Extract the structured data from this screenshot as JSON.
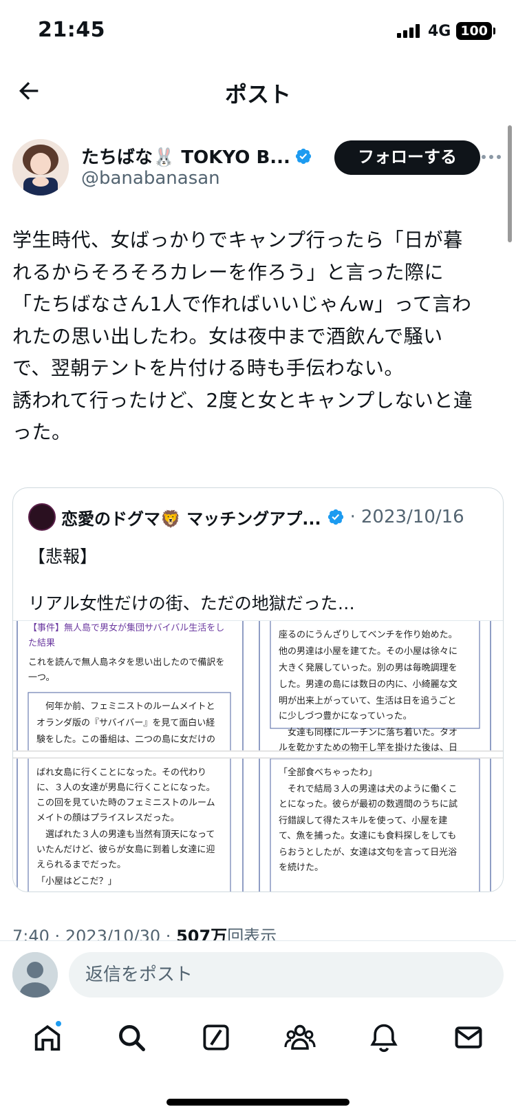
{
  "status_bar": {
    "time": "21:45",
    "network": "4G",
    "battery": "100"
  },
  "header": {
    "title": "ポスト"
  },
  "author": {
    "display_name": "たちばな🐰 TOKYO B...",
    "handle": "@banabanasan",
    "follow_label": "フォローする"
  },
  "post": {
    "text": "学生時代、女ばっかりでキャンプ行ったら「日が暮\nれるからそろそろカレーを作ろう」と言った際に\n「たちばなさん1人で作ればいいじゃんw」って言わ\nれたの思い出したわ。女は夜中まで酒飲んで騒い\nで、翌朝テントを片付ける時も手伝わない。\n誘われて行ったけど、2度と女とキャンプしないと違\nった。"
  },
  "quote": {
    "display_name": "恋愛のドグマ🦁 マッチングアプ...",
    "separator": "·",
    "date": "2023/10/16",
    "tag": "【悲報】",
    "text": "リアル女性だけの街、ただの地獄だった…",
    "image_left": {
      "heading": [
        "【事件】無人島で男女が集団サバイバル生活をし",
        "た結果"
      ],
      "lines": [
        "これを読んで無人島ネタを思い出したので備訳を",
        "一つ。",
        "　何年か前、フェミニストのルームメイトと",
        "オランダ版の『サバイバー』を見て面白い経",
        "験をした。この番組は、二つの島に女だけの",
        "ばれ女島に行くことになった。その代わり",
        "に、３人の女達が男島に行くことになった。",
        "この回を見ていた時のフェミニストのルーム",
        "メイトの顔はプライスレスだった。",
        "　選ばれた３人の男達も当然有頂天になって",
        "いたんだけど、彼らが女島に到着し女達に迎",
        "えられるまでだった。",
        "「小屋はどこだ？」"
      ]
    },
    "image_right": {
      "lines": [
        "座るのにうんざりしてベンチを作り始めた。",
        "他の男達は小屋を建てた。その小屋は徐々に",
        "大きく発展していった。別の男は毎晩調理を",
        "した。男達の島には数日の内に、小綺麗な文",
        "明が出来上がっていて、生活は日を追うごと",
        "に少しづつ豊かになっていった。",
        "　女達も同様にルーチンに落ち着いた。タオ",
        "ルを乾かすための物干し竿を掛けた後は、日",
        "「全部食べちゃったわ」",
        "　それで結局３人の男達は犬のように働くこ",
        "とになった。彼らが最初の数週間のうちに試",
        "行錯誤して得たスキルを使って、小屋を建",
        "て、魚を捕った。女達にも食料探しをしても",
        "らおうとしたが、女達は文句を言って日光浴",
        "を続けた。"
      ]
    }
  },
  "meta": {
    "time": "7:40",
    "sep1": "·",
    "date": "2023/10/30",
    "sep2": "·",
    "views": "507万",
    "views_label": "回表示"
  },
  "reply": {
    "placeholder": "返信をポスト"
  },
  "tabs": [
    "home",
    "search",
    "grok",
    "communities",
    "notifications",
    "messages"
  ]
}
